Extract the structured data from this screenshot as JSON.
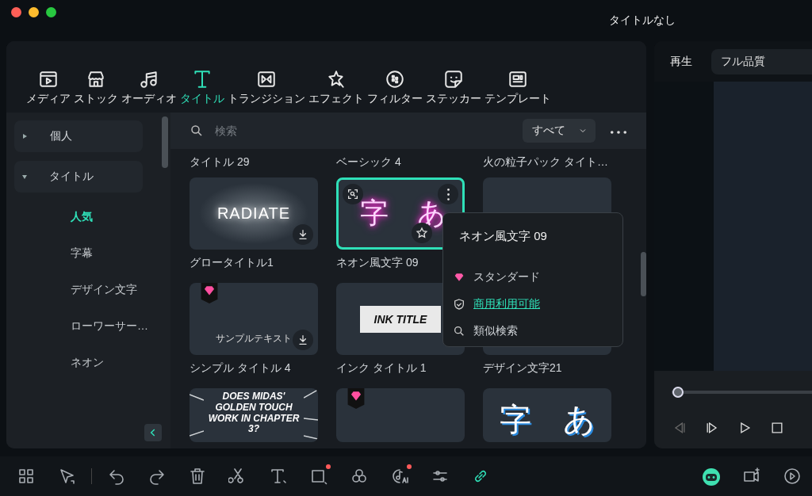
{
  "window": {
    "title": "タイトルなし"
  },
  "tabs": [
    {
      "label": "メディア",
      "selected": false
    },
    {
      "label": "ストック",
      "selected": false
    },
    {
      "label": "オーディオ",
      "selected": false
    },
    {
      "label": "タイトル",
      "selected": true
    },
    {
      "label": "トランジション",
      "selected": false
    },
    {
      "label": "エフェクト",
      "selected": false
    },
    {
      "label": "フィルター",
      "selected": false
    },
    {
      "label": "ステッカー",
      "selected": false
    },
    {
      "label": "テンプレート",
      "selected": false
    }
  ],
  "sidebar": {
    "items": [
      {
        "label": "個人",
        "expanded": false
      },
      {
        "label": "タイトル",
        "expanded": true,
        "children": [
          {
            "label": "人気",
            "selected": true
          },
          {
            "label": "字幕",
            "selected": false
          },
          {
            "label": "デザイン文字",
            "selected": false
          },
          {
            "label": "ローワーサー…",
            "selected": false
          },
          {
            "label": "ネオン",
            "selected": false
          }
        ]
      }
    ]
  },
  "search": {
    "placeholder": "検索",
    "filter": "すべて"
  },
  "grid": {
    "above_labels": [
      "タイトル 29",
      "ベーシック 4",
      "火の粒子パック タイト…"
    ],
    "cards": [
      {
        "label": "グロータイトル1",
        "preview": {
          "kind": "glow",
          "text": "RADIATE"
        },
        "premium": false,
        "selected": false,
        "download": true
      },
      {
        "label": "ネオン風文字 09",
        "preview": {
          "kind": "neon",
          "text": "字　あ"
        },
        "premium": false,
        "selected": true,
        "favorite": true
      },
      {
        "preview": {
          "kind": "blank"
        },
        "premium": false,
        "selected": false
      },
      {
        "label": "シンプル タイトル 4",
        "preview": {
          "kind": "plain",
          "text": "サンプルテキスト"
        },
        "premium": true,
        "selected": false,
        "download": true
      },
      {
        "label": "インク タイトル 1",
        "preview": {
          "kind": "ink",
          "text": "INK TITLE"
        },
        "premium": false,
        "selected": false
      },
      {
        "label": "デザイン文字21",
        "preview": {
          "kind": "blank"
        },
        "selected": false
      },
      {
        "preview": {
          "kind": "comic",
          "text": "DOES MIDAS' GOLDEN TOUCH WORK IN CHAPTER 3?"
        },
        "premium": false,
        "selected": false
      },
      {
        "preview": {
          "kind": "blank"
        },
        "premium": true,
        "selected": false
      },
      {
        "preview": {
          "kind": "outline",
          "text": "字　あ"
        },
        "premium": false,
        "selected": false
      }
    ]
  },
  "popup": {
    "title": "ネオン風文字 09",
    "items": [
      {
        "kind": "plan",
        "label": "スタンダード"
      },
      {
        "kind": "link",
        "label": "商用利用可能"
      },
      {
        "kind": "search",
        "label": "類似検索"
      }
    ]
  },
  "player": {
    "tab": "再生",
    "quality": "フル品質",
    "progress": {
      "level": 0
    }
  },
  "toolbar": {
    "items": [
      {
        "active": false,
        "notification": false
      },
      {
        "active": false,
        "notification": false
      },
      {
        "active": false,
        "notification": false
      },
      {
        "active": false,
        "notification": false
      },
      {
        "active": false,
        "notification": false
      },
      {
        "active": false,
        "notification": false
      },
      {
        "active": false,
        "notification": false
      },
      {
        "active": false,
        "notification": true
      },
      {
        "active": false,
        "notification": false
      },
      {
        "active": false,
        "notification": true
      },
      {
        "active": false,
        "notification": false
      },
      {
        "active": true,
        "notification": false
      }
    ],
    "right": [
      {
        "active": true
      },
      {
        "active": false
      },
      {
        "active": false
      }
    ]
  }
}
